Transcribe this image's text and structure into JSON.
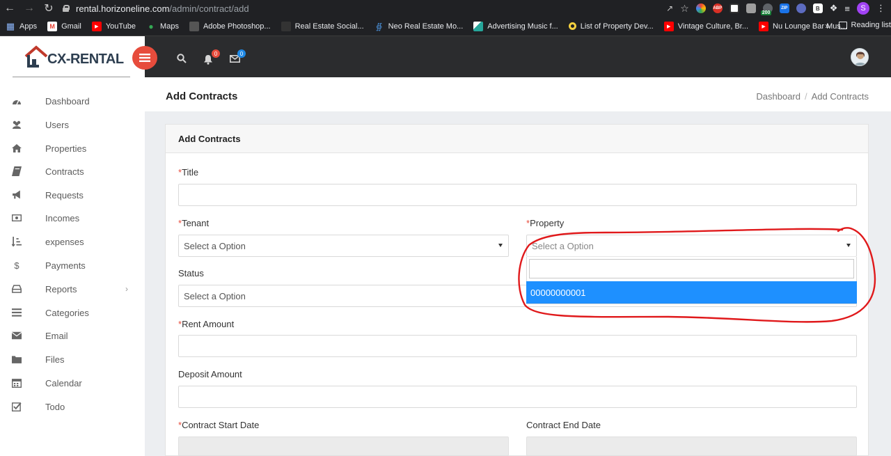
{
  "browser": {
    "url_host": "rental.horizoneline.com",
    "url_path": "/admin/contract/add",
    "extensions_badge": "200",
    "extension_abp": "ABP",
    "extension_zip": "ZIP",
    "extension_b": "B",
    "profile_initial": "S",
    "bookmarks": [
      {
        "label": "Apps",
        "icon": "apps-grid-icon",
        "color": "#e8eaed"
      },
      {
        "label": "Gmail",
        "icon": "gmail-icon",
        "color": "#ea4335"
      },
      {
        "label": "YouTube",
        "icon": "youtube-icon",
        "color": "#ff0000"
      },
      {
        "label": "Maps",
        "icon": "maps-pin-icon",
        "color": "#34a853"
      },
      {
        "label": "Adobe Photoshop...",
        "icon": "photoshop-icon",
        "color": "#444"
      },
      {
        "label": "Real Estate Social...",
        "icon": "real-estate-icon",
        "color": "#222"
      },
      {
        "label": "Neo Real Estate Mo...",
        "icon": "neo-icon",
        "color": "#4a90d9"
      },
      {
        "label": "Advertising Music f...",
        "icon": "music-icon",
        "color": "#26a69a"
      },
      {
        "label": "List of Property Dev...",
        "icon": "circle-icon",
        "color": "#f4d03f"
      },
      {
        "label": "Vintage Culture, Br...",
        "icon": "youtube-icon",
        "color": "#ff0000"
      },
      {
        "label": "Nu Lounge Bar Mus...",
        "icon": "youtube-icon",
        "color": "#ff0000"
      }
    ],
    "more": "»",
    "reading_list": "Reading list"
  },
  "header": {
    "logo_text": "CX-RENTAL",
    "notifications_count": "0",
    "messages_count": "0",
    "accent": "#e74c3c",
    "badge_blue": "#1e88e5"
  },
  "sidebar": {
    "items": [
      {
        "label": "Dashboard",
        "icon": "dashboard-icon"
      },
      {
        "label": "Users",
        "icon": "users-icon"
      },
      {
        "label": "Properties",
        "icon": "home-icon"
      },
      {
        "label": "Contracts",
        "icon": "book-icon"
      },
      {
        "label": "Requests",
        "icon": "megaphone-icon"
      },
      {
        "label": "Incomes",
        "icon": "money-icon"
      },
      {
        "label": "expenses",
        "icon": "sort-list-icon"
      },
      {
        "label": "Payments",
        "icon": "dollar-icon"
      },
      {
        "label": "Reports",
        "icon": "inbox-icon"
      },
      {
        "label": "Categories",
        "icon": "list-icon"
      },
      {
        "label": "Email",
        "icon": "envelope-icon"
      },
      {
        "label": "Files",
        "icon": "folder-icon"
      },
      {
        "label": "Calendar",
        "icon": "calendar-icon"
      },
      {
        "label": "Todo",
        "icon": "checkbox-icon"
      }
    ],
    "reports_chevron": "›"
  },
  "page": {
    "title": "Add Contracts",
    "breadcrumb_home": "Dashboard",
    "breadcrumb_sep": "/",
    "breadcrumb_current": "Add Contracts"
  },
  "form": {
    "card_title": "Add Contracts",
    "required_mark": "*",
    "title_label": "Title",
    "tenant_label": "Tenant",
    "tenant_value": "Select a Option",
    "property_label": "Property",
    "property_value": "Select a Option",
    "status_label": "Status",
    "status_value": "Select a Option",
    "rent_label": "Rent Amount",
    "deposit_label": "Deposit Amount",
    "start_label": "Contract Start Date",
    "end_label": "Contract End Date",
    "property_options": [
      "00000000001"
    ],
    "highlight_color": "#1e90ff"
  },
  "annotation": {
    "color": "#e0191b"
  }
}
